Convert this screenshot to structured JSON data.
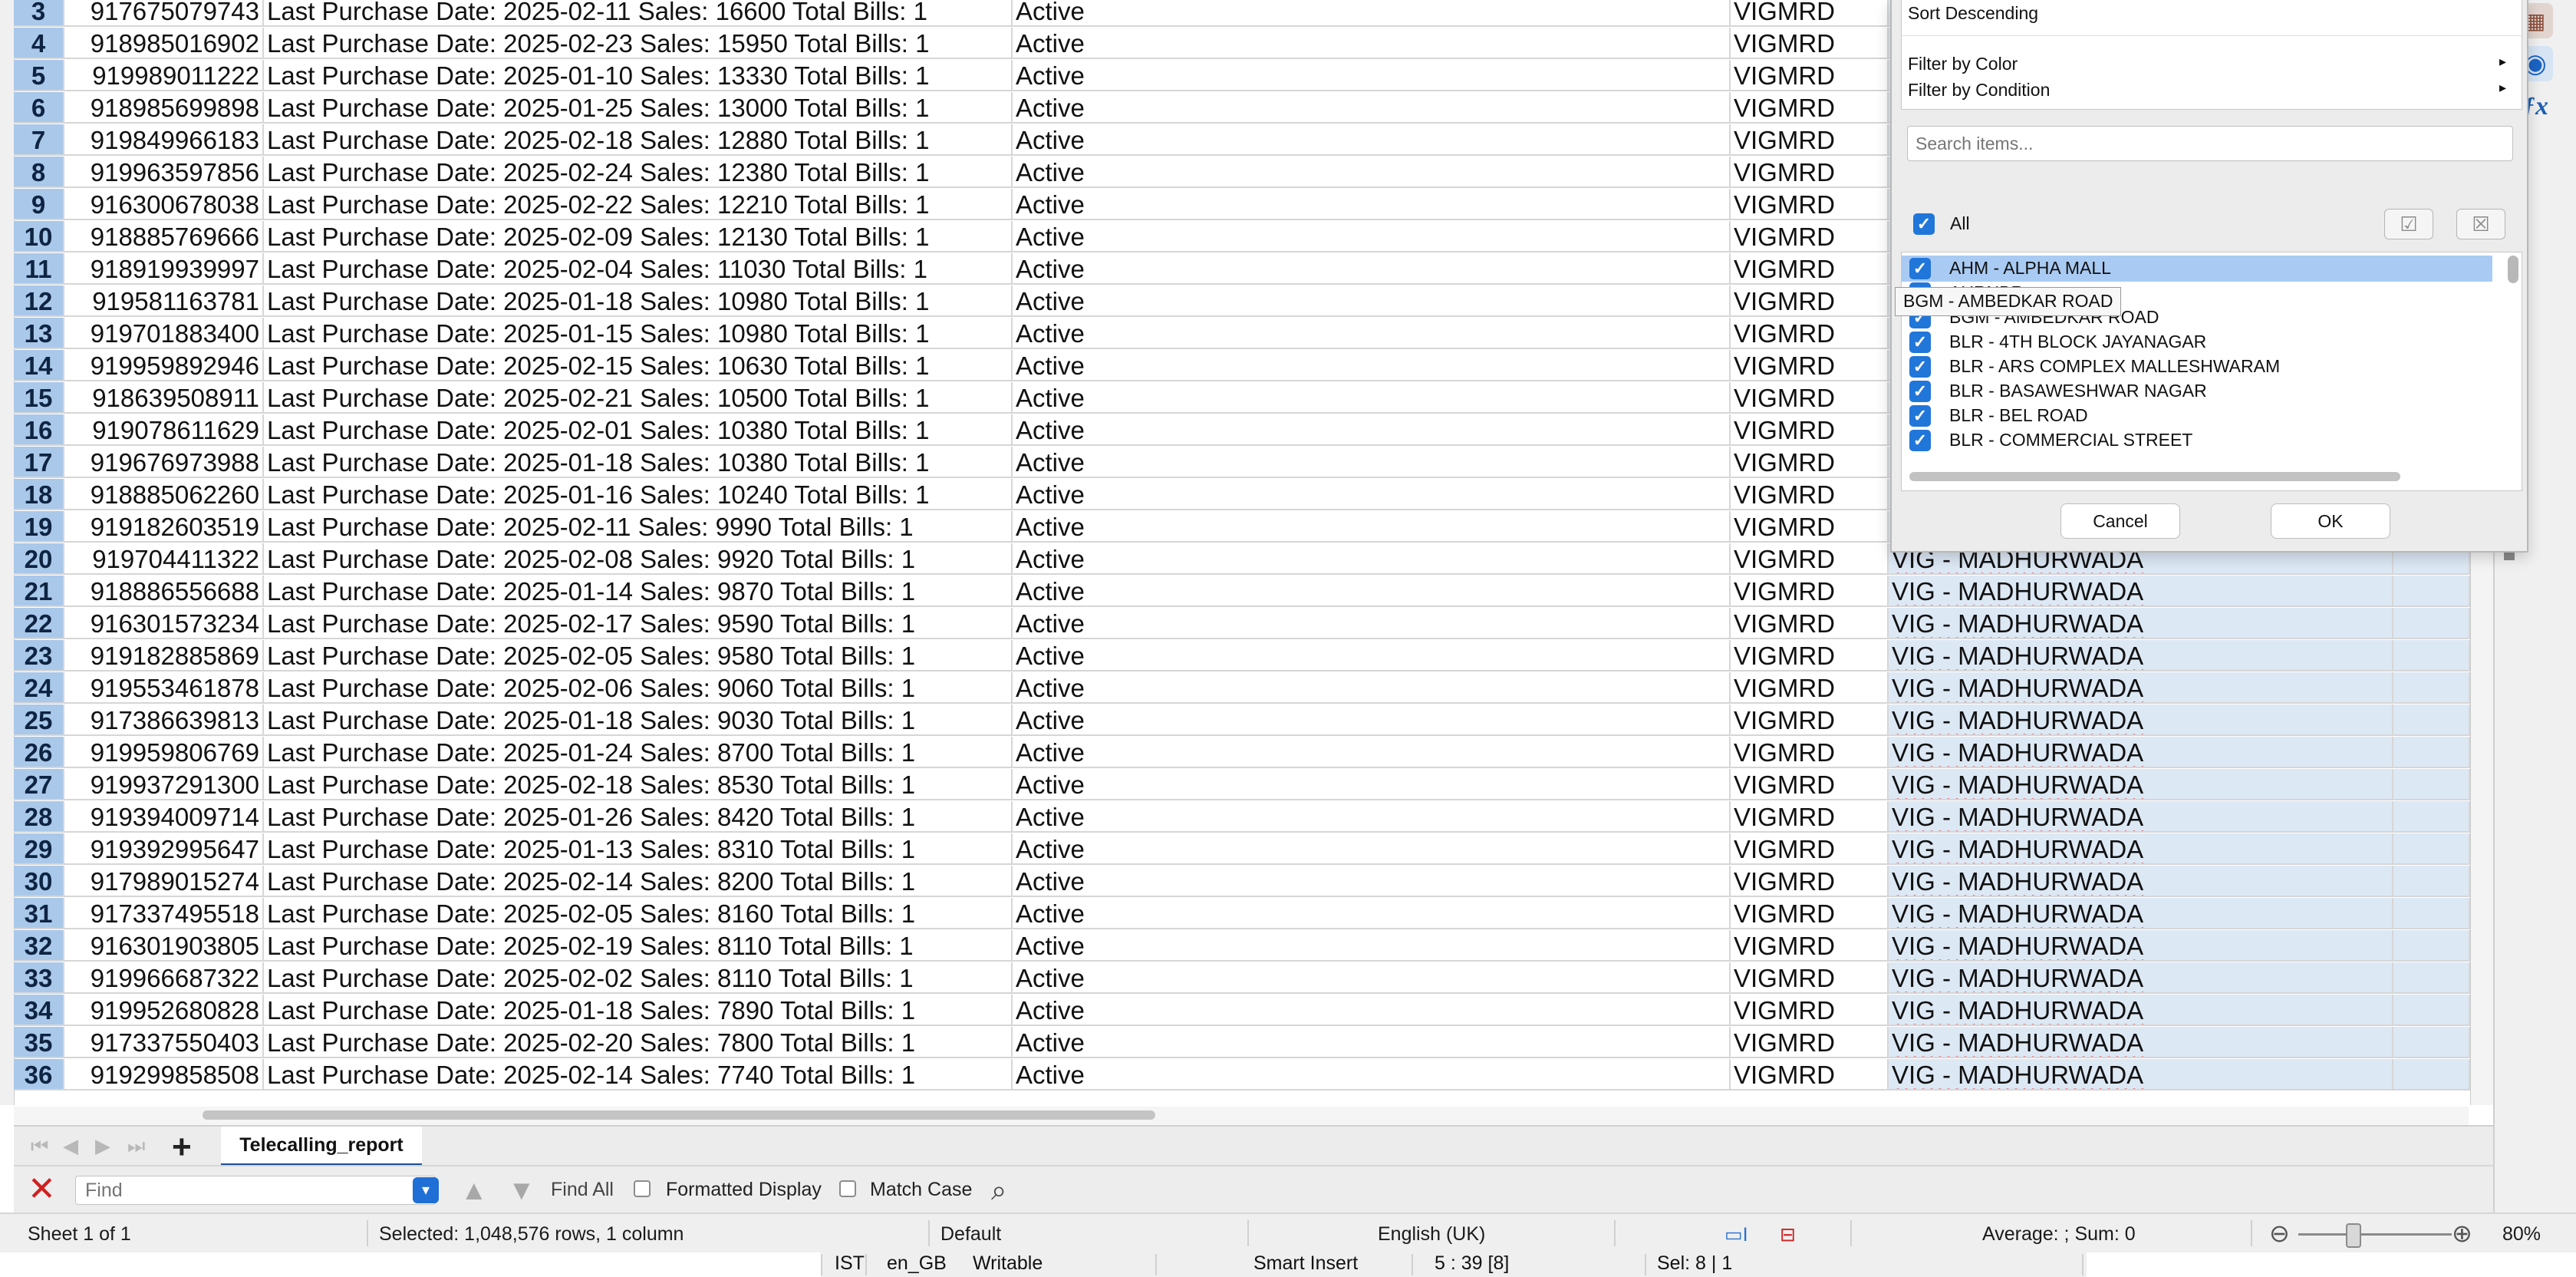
{
  "sheet": {
    "rows": [
      {
        "n": "3",
        "phone": "917675079743",
        "date": "Last Purchase Date: 2025-02-11",
        "sales": "Sales: 16600 Total Bills: 1",
        "status": "Active",
        "code": "VIGMRD",
        "store": ""
      },
      {
        "n": "4",
        "phone": "918985016902",
        "date": "Last Purchase Date: 2025-02-23",
        "sales": "Sales: 15950 Total Bills: 1",
        "status": "Active",
        "code": "VIGMRD",
        "store": ""
      },
      {
        "n": "5",
        "phone": "919989011222",
        "date": "Last Purchase Date: 2025-01-10",
        "sales": "Sales: 13330 Total Bills: 1",
        "status": "Active",
        "code": "VIGMRD",
        "store": ""
      },
      {
        "n": "6",
        "phone": "918985699898",
        "date": "Last Purchase Date: 2025-01-25",
        "sales": "Sales: 13000 Total Bills: 1",
        "status": "Active",
        "code": "VIGMRD",
        "store": ""
      },
      {
        "n": "7",
        "phone": "919849966183",
        "date": "Last Purchase Date: 2025-02-18",
        "sales": "Sales: 12880 Total Bills: 1",
        "status": "Active",
        "code": "VIGMRD",
        "store": ""
      },
      {
        "n": "8",
        "phone": "919963597856",
        "date": "Last Purchase Date: 2025-02-24",
        "sales": "Sales: 12380 Total Bills: 1",
        "status": "Active",
        "code": "VIGMRD",
        "store": ""
      },
      {
        "n": "9",
        "phone": "916300678038",
        "date": "Last Purchase Date: 2025-02-22",
        "sales": "Sales: 12210 Total Bills: 1",
        "status": "Active",
        "code": "VIGMRD",
        "store": ""
      },
      {
        "n": "10",
        "phone": "918885769666",
        "date": "Last Purchase Date: 2025-02-09",
        "sales": "Sales: 12130 Total Bills: 1",
        "status": "Active",
        "code": "VIGMRD",
        "store": ""
      },
      {
        "n": "11",
        "phone": "918919939997",
        "date": "Last Purchase Date: 2025-02-04",
        "sales": "Sales: 11030 Total Bills: 1",
        "status": "Active",
        "code": "VIGMRD",
        "store": ""
      },
      {
        "n": "12",
        "phone": "919581163781",
        "date": "Last Purchase Date: 2025-01-18",
        "sales": "Sales: 10980 Total Bills: 1",
        "status": "Active",
        "code": "VIGMRD",
        "store": ""
      },
      {
        "n": "13",
        "phone": "919701883400",
        "date": "Last Purchase Date: 2025-01-15",
        "sales": "Sales: 10980 Total Bills: 1",
        "status": "Active",
        "code": "VIGMRD",
        "store": ""
      },
      {
        "n": "14",
        "phone": "919959892946",
        "date": "Last Purchase Date: 2025-02-15",
        "sales": "Sales: 10630 Total Bills: 1",
        "status": "Active",
        "code": "VIGMRD",
        "store": ""
      },
      {
        "n": "15",
        "phone": "918639508911",
        "date": "Last Purchase Date: 2025-02-21",
        "sales": "Sales: 10500 Total Bills: 1",
        "status": "Active",
        "code": "VIGMRD",
        "store": ""
      },
      {
        "n": "16",
        "phone": "919078611629",
        "date": "Last Purchase Date: 2025-02-01",
        "sales": "Sales: 10380 Total Bills: 1",
        "status": "Active",
        "code": "VIGMRD",
        "store": ""
      },
      {
        "n": "17",
        "phone": "919676973988",
        "date": "Last Purchase Date: 2025-01-18",
        "sales": "Sales: 10380 Total Bills: 1",
        "status": "Active",
        "code": "VIGMRD",
        "store": ""
      },
      {
        "n": "18",
        "phone": "918885062260",
        "date": "Last Purchase Date: 2025-01-16",
        "sales": "Sales: 10240 Total Bills: 1",
        "status": "Active",
        "code": "VIGMRD",
        "store": ""
      },
      {
        "n": "19",
        "phone": "919182603519",
        "date": "Last Purchase Date: 2025-02-11",
        "sales": "Sales: 9990 Total Bills: 1",
        "status": "Active",
        "code": "VIGMRD",
        "store": ""
      },
      {
        "n": "20",
        "phone": "919704411322",
        "date": "Last Purchase Date: 2025-02-08",
        "sales": "Sales: 9920 Total Bills: 1",
        "status": "Active",
        "code": "VIGMRD",
        "store": "VIG - MADHURWADA"
      },
      {
        "n": "21",
        "phone": "918886556688",
        "date": "Last Purchase Date: 2025-01-14",
        "sales": "Sales: 9870 Total Bills: 1",
        "status": "Active",
        "code": "VIGMRD",
        "store": "VIG - MADHURWADA"
      },
      {
        "n": "22",
        "phone": "916301573234",
        "date": "Last Purchase Date: 2025-02-17",
        "sales": "Sales: 9590 Total Bills: 1",
        "status": "Active",
        "code": "VIGMRD",
        "store": "VIG - MADHURWADA"
      },
      {
        "n": "23",
        "phone": "919182885869",
        "date": "Last Purchase Date: 2025-02-05",
        "sales": "Sales: 9580 Total Bills: 1",
        "status": "Active",
        "code": "VIGMRD",
        "store": "VIG - MADHURWADA"
      },
      {
        "n": "24",
        "phone": "919553461878",
        "date": "Last Purchase Date: 2025-02-06",
        "sales": "Sales: 9060 Total Bills: 1",
        "status": "Active",
        "code": "VIGMRD",
        "store": "VIG - MADHURWADA"
      },
      {
        "n": "25",
        "phone": "917386639813",
        "date": "Last Purchase Date: 2025-01-18",
        "sales": "Sales: 9030 Total Bills: 1",
        "status": "Active",
        "code": "VIGMRD",
        "store": "VIG - MADHURWADA"
      },
      {
        "n": "26",
        "phone": "919959806769",
        "date": "Last Purchase Date: 2025-01-24",
        "sales": "Sales: 8700 Total Bills: 1",
        "status": "Active",
        "code": "VIGMRD",
        "store": "VIG - MADHURWADA"
      },
      {
        "n": "27",
        "phone": "919937291300",
        "date": "Last Purchase Date: 2025-02-18",
        "sales": "Sales: 8530 Total Bills: 1",
        "status": "Active",
        "code": "VIGMRD",
        "store": "VIG - MADHURWADA"
      },
      {
        "n": "28",
        "phone": "919394009714",
        "date": "Last Purchase Date: 2025-01-26",
        "sales": "Sales: 8420 Total Bills: 1",
        "status": "Active",
        "code": "VIGMRD",
        "store": "VIG - MADHURWADA"
      },
      {
        "n": "29",
        "phone": "919392995647",
        "date": "Last Purchase Date: 2025-01-13",
        "sales": "Sales: 8310 Total Bills: 1",
        "status": "Active",
        "code": "VIGMRD",
        "store": "VIG - MADHURWADA"
      },
      {
        "n": "30",
        "phone": "917989015274",
        "date": "Last Purchase Date: 2025-02-14",
        "sales": "Sales: 8200 Total Bills: 1",
        "status": "Active",
        "code": "VIGMRD",
        "store": "VIG - MADHURWADA"
      },
      {
        "n": "31",
        "phone": "917337495518",
        "date": "Last Purchase Date: 2025-02-05",
        "sales": "Sales: 8160 Total Bills: 1",
        "status": "Active",
        "code": "VIGMRD",
        "store": "VIG - MADHURWADA"
      },
      {
        "n": "32",
        "phone": "916301903805",
        "date": "Last Purchase Date: 2025-02-19",
        "sales": "Sales: 8110 Total Bills: 1",
        "status": "Active",
        "code": "VIGMRD",
        "store": "VIG - MADHURWADA"
      },
      {
        "n": "33",
        "phone": "919966687322",
        "date": "Last Purchase Date: 2025-02-02",
        "sales": "Sales: 8110 Total Bills: 1",
        "status": "Active",
        "code": "VIGMRD",
        "store": "VIG - MADHURWADA"
      },
      {
        "n": "34",
        "phone": "919952680828",
        "date": "Last Purchase Date: 2025-01-18",
        "sales": "Sales: 7890 Total Bills: 1",
        "status": "Active",
        "code": "VIGMRD",
        "store": "VIG - MADHURWADA"
      },
      {
        "n": "35",
        "phone": "917337550403",
        "date": "Last Purchase Date: 2025-02-20",
        "sales": "Sales: 7800 Total Bills: 1",
        "status": "Active",
        "code": "VIGMRD",
        "store": "VIG - MADHURWADA"
      },
      {
        "n": "36",
        "phone": "919299858508",
        "date": "Last Purchase Date: 2025-02-14",
        "sales": "Sales: 7740 Total Bills: 1",
        "status": "Active",
        "code": "VIGMRD",
        "store": "VIG - MADHURWADA"
      }
    ]
  },
  "filter": {
    "menu": {
      "sort_descending": "Sort Descending",
      "filter_by_color": "Filter by Color",
      "filter_by_condition": "Filter by Condition"
    },
    "search_placeholder": "Search items...",
    "all_label": "All",
    "items": [
      {
        "label": "AHM - ALPHA MALL",
        "checked": true,
        "selected": true
      },
      {
        "label": "AURNBR",
        "checked": true,
        "selected": false
      },
      {
        "label": "BGM - AMBEDKAR ROAD",
        "checked": true,
        "selected": false
      },
      {
        "label": "BLR - 4TH BLOCK JAYANAGAR",
        "checked": true,
        "selected": false
      },
      {
        "label": "BLR - ARS COMPLEX MALLESHWARAM",
        "checked": true,
        "selected": false
      },
      {
        "label": "BLR - BASAWESHWAR NAGAR",
        "checked": true,
        "selected": false
      },
      {
        "label": "BLR - BEL ROAD",
        "checked": true,
        "selected": false
      },
      {
        "label": "BLR - COMMERCIAL STREET",
        "checked": true,
        "selected": false
      }
    ],
    "tooltip": "BGM - AMBEDKAR ROAD",
    "cancel": "Cancel",
    "ok": "OK"
  },
  "tabs": {
    "sheet_name": "Telecalling_report"
  },
  "findbar": {
    "placeholder": "Find",
    "find_all": "Find All",
    "formatted_display": "Formatted Display",
    "match_case": "Match Case"
  },
  "status": {
    "sheet": "Sheet 1 of 1",
    "selection": "Selected: 1,048,576 rows, 1 column",
    "page_style": "Default",
    "language": "English (UK)",
    "summary": "Average: ; Sum: 0",
    "zoom": "80%"
  },
  "os_status": {
    "timezone": "IST",
    "locale": "en_GB",
    "mode": "Writable",
    "insert": "Smart Insert",
    "position": "5 : 39 [8]",
    "sel": "Sel: 8 | 1"
  },
  "colors": {
    "accent": "#2176d9",
    "row_header": "#a9c8ea",
    "selected_column": "#dde8f5"
  },
  "icons": {
    "close": "close-icon",
    "navigator": "navigator-icon",
    "functions": "functions-icon",
    "binoculars": "binoculars-icon"
  }
}
